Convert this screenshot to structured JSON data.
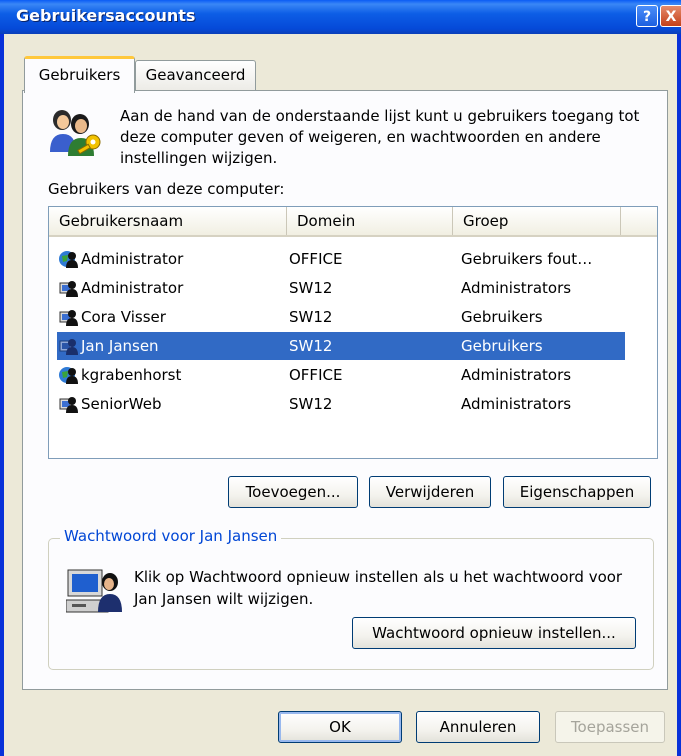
{
  "window": {
    "title": "Gebruikersaccounts",
    "help_glyph": "?",
    "close_glyph": "X"
  },
  "tabs": [
    {
      "label": "Gebruikers",
      "active": true
    },
    {
      "label": "Geavanceerd",
      "active": false
    }
  ],
  "info_text": "Aan de hand van de onderstaande lijst kunt u gebruikers toegang tot deze computer geven of weigeren, en wachtwoorden en andere instellingen wijzigen.",
  "users_label": "Gebruikers van deze computer:",
  "table": {
    "columns": [
      "Gebruikersnaam",
      "Domein",
      "Groep"
    ],
    "rows": [
      {
        "name": "Administrator",
        "domain": "OFFICE",
        "group": "Gebruikers fout…",
        "icon": "domain-user-icon"
      },
      {
        "name": "Administrator",
        "domain": "SW12",
        "group": "Administrators",
        "icon": "local-user-icon"
      },
      {
        "name": "Cora Visser",
        "domain": "SW12",
        "group": "Gebruikers",
        "icon": "local-user-icon"
      },
      {
        "name": "Jan Jansen",
        "domain": "SW12",
        "group": "Gebruikers",
        "icon": "local-user-icon",
        "selected": true
      },
      {
        "name": "kgrabenhorst",
        "domain": "OFFICE",
        "group": "Administrators",
        "icon": "domain-user-icon"
      },
      {
        "name": "SeniorWeb",
        "domain": "SW12",
        "group": "Administrators",
        "icon": "local-user-icon"
      }
    ]
  },
  "list_buttons": {
    "add": "Toevoegen...",
    "remove": "Verwijderen",
    "properties": "Eigenschappen"
  },
  "password_group": {
    "legend": "Wachtwoord voor Jan Jansen",
    "text": "Klik op Wachtwoord opnieuw instellen als u het wachtwoord voor Jan Jansen wilt wijzigen.",
    "reset_button": "Wachtwoord opnieuw instellen..."
  },
  "dialog_buttons": {
    "ok": "OK",
    "cancel": "Annuleren",
    "apply": "Toepassen"
  },
  "colors": {
    "selection": "#316ac5",
    "title_bar": "#0a5cf5",
    "group_legend": "#0046d5",
    "active_tab_accent": "#ffc83c"
  }
}
